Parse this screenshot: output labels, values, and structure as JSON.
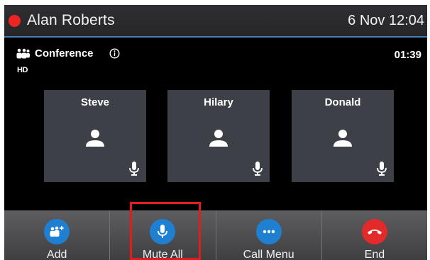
{
  "status_bar": {
    "caller_name": "Alan Roberts",
    "datetime": "6 Nov 12:04",
    "status_color": "#ee2424"
  },
  "conference": {
    "title": "Conference",
    "hd_label": "HD",
    "timer": "01:39"
  },
  "participants": [
    {
      "name": "Steve",
      "mic_icon": "microphone-icon"
    },
    {
      "name": "Hilary",
      "mic_icon": "microphone-icon"
    },
    {
      "name": "Donald",
      "mic_icon": "microphone-icon"
    }
  ],
  "softkeys": [
    {
      "label": "Add",
      "icon": "add-participant-icon",
      "color": "#1f7fd0"
    },
    {
      "label": "Mute All",
      "icon": "microphone-icon",
      "color": "#1f7fd0",
      "highlighted": true
    },
    {
      "label": "Call Menu",
      "icon": "more-icon",
      "color": "#1f7fd0"
    },
    {
      "label": "End",
      "icon": "end-call-icon",
      "color": "#e22a2a"
    }
  ],
  "colors": {
    "accent": "#1f7fd0",
    "end": "#e22a2a",
    "highlight": "#e21c1c",
    "tile": "#3d4047"
  }
}
